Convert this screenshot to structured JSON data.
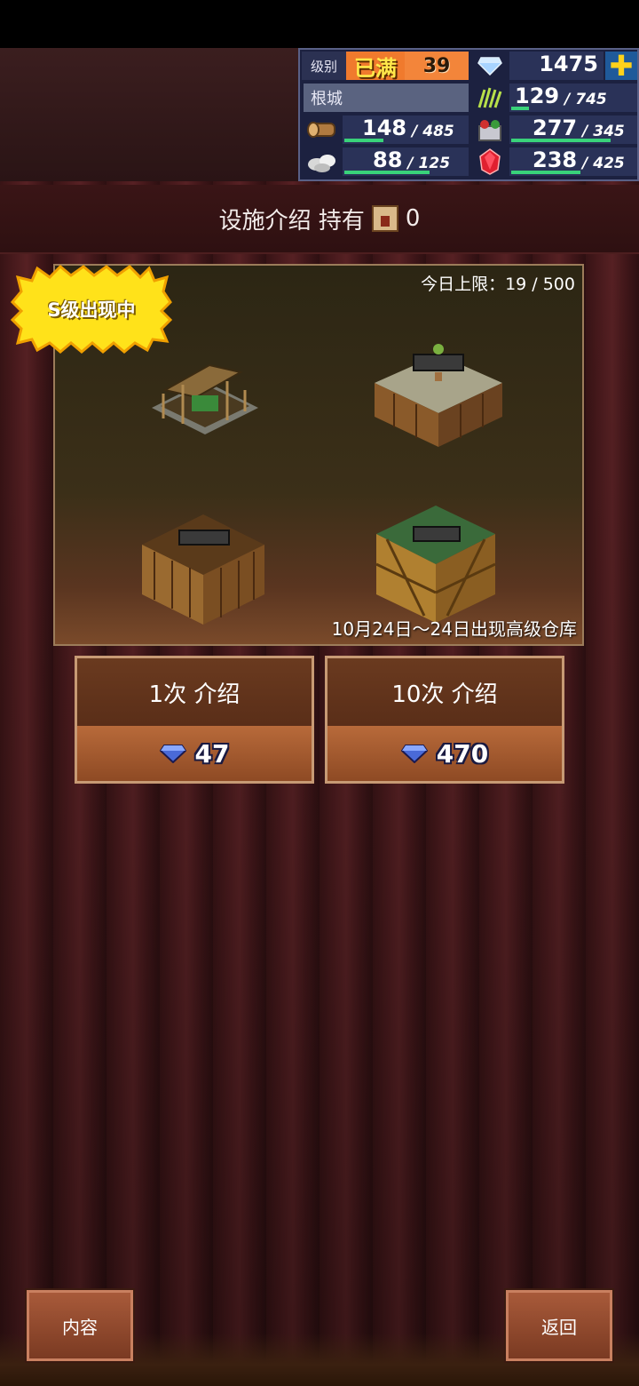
{
  "resources": {
    "level_label": "级别",
    "level_status": "已满",
    "level_value": "39",
    "gems": "1475",
    "castle_name": "根城",
    "grass": {
      "current": "129",
      "max": "/ 745",
      "fraction": 0.17
    },
    "wood": {
      "current": "148",
      "max": "/ 485",
      "fraction": 0.31
    },
    "food": {
      "current": "277",
      "max": "/ 345",
      "fraction": 0.8
    },
    "stone": {
      "current": "88",
      "max": "/ 125",
      "fraction": 0.7
    },
    "ruby": {
      "current": "238",
      "max": "/ 425",
      "fraction": 0.56
    }
  },
  "title": {
    "text": "设施介绍 持有",
    "held_count": "0"
  },
  "showcase": {
    "daily_limit": "今日上限：19 / 500",
    "badge": "S级出现中",
    "event_text": "10月24日～24日出现高级仓库"
  },
  "buttons": {
    "single": {
      "label": "1次 介绍",
      "cost": "47"
    },
    "ten": {
      "label": "10次 介绍",
      "cost": "470"
    }
  },
  "bottom": {
    "content": "内容",
    "back": "返回"
  }
}
